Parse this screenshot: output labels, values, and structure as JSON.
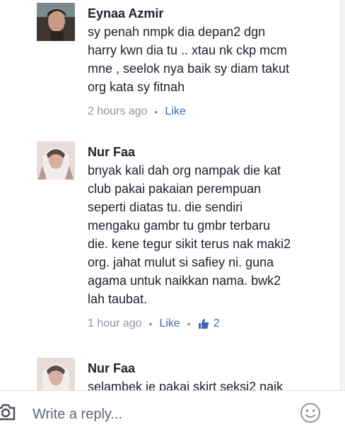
{
  "comments": [
    {
      "author": "Eynaa Azmir",
      "text": "sy penah nmpk dia depan2 dgn\nharry kwn dia tu .. xtau nk ckp mcm\nmne , seelok nya baik sy diam takut\norg kata sy fitnah",
      "time": "2 hours ago",
      "like_label": "Like"
    },
    {
      "author": "Nur Faa",
      "text": "bnyak kali dah org nampak die kat\nclub pakai pakaian perempuan\nseperti diatas tu. die sendiri\nmengaku gambr tu gmbr terbaru\ndie. kene tegur sikit terus nak maki2\norg. jahat mulut si safiey ni. guna\nagama untuk naikkan nama. bwk2\nlah taubat.",
      "time": "1 hour ago",
      "like_label": "Like",
      "like_count": "2"
    },
    {
      "author": "Nur Faa",
      "text": "selambek je pakai skirt seksi2 naik"
    }
  ],
  "separator": "•",
  "reply": {
    "placeholder": "Write a reply..."
  },
  "icons": {
    "camera": "camera-icon",
    "emoji": "smiley-icon",
    "like": "thumbs-up-icon"
  },
  "colors": {
    "link": "#4267b2",
    "meta": "#90949c",
    "text": "#1d2129"
  }
}
